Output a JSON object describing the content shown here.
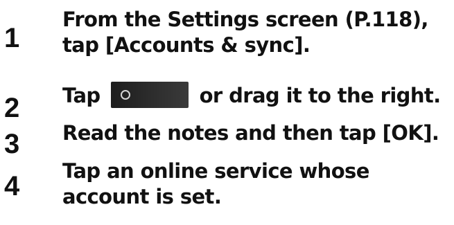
{
  "steps": [
    {
      "number": "1",
      "lines": [
        "From the Settings screen (P.118),",
        "tap [Accounts & sync]."
      ]
    },
    {
      "number": "2",
      "before_icon": "Tap",
      "icon": "toggle-switch-off",
      "after_icon": "or drag it to the right."
    },
    {
      "number": "3",
      "lines": [
        "Read the notes and then tap [OK]."
      ]
    },
    {
      "number": "4",
      "lines": [
        "Tap an online service whose",
        "account is set."
      ]
    }
  ]
}
